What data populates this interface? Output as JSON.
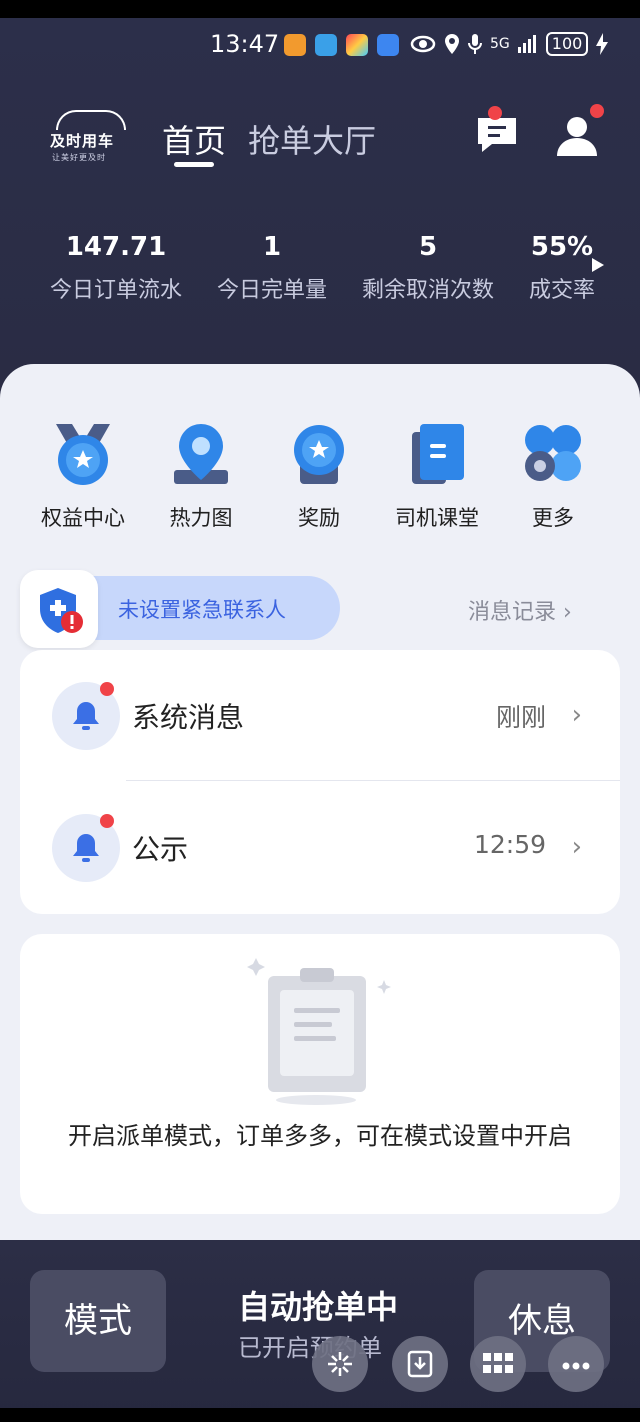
{
  "status_bar": {
    "time": "13:47",
    "network": "5G",
    "battery": "100"
  },
  "brand": {
    "name": "及时用车",
    "slogan": "让美好更及时"
  },
  "nav": {
    "tab_home": "首页",
    "tab_hall": "抢单大厅"
  },
  "stats": [
    {
      "value": "147.71",
      "label": "今日订单流水"
    },
    {
      "value": "1",
      "label": "今日完单量"
    },
    {
      "value": "5",
      "label": "剩余取消次数"
    },
    {
      "value": "55%",
      "label": "成交率"
    }
  ],
  "quick_actions": [
    {
      "label": "权益中心",
      "icon": "medal-star-icon"
    },
    {
      "label": "热力图",
      "icon": "map-pin-icon"
    },
    {
      "label": "奖励",
      "icon": "award-badge-icon"
    },
    {
      "label": "司机课堂",
      "icon": "book-icon"
    },
    {
      "label": "更多",
      "icon": "more-apps-icon"
    }
  ],
  "emergency": {
    "text": "未设置紧急联系人"
  },
  "message_log": {
    "label": "消息记录 ›"
  },
  "messages": [
    {
      "title": "系统消息",
      "time": "刚刚"
    },
    {
      "title": "公示",
      "time": "12:59"
    }
  ],
  "dispatch": {
    "text": "开启派单模式，订单多多，可在模式设置中开启"
  },
  "bottom": {
    "mode_label": "模式",
    "rest_label": "休息",
    "auto_title": "自动抢单中",
    "auto_sub": "已开启预约单"
  },
  "colors": {
    "accent": "#3b63e0",
    "header_bg": "#2c2f4a",
    "badge": "#f04348"
  }
}
